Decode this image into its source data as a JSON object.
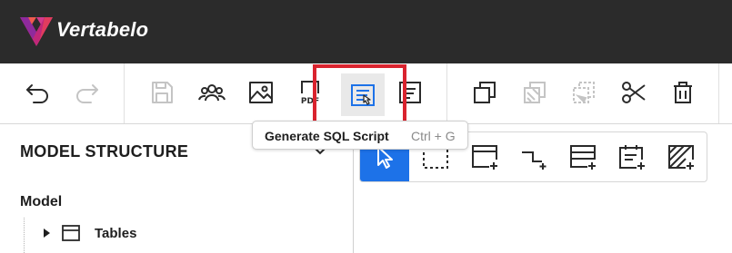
{
  "app": {
    "brand": "Vertabelo"
  },
  "toolbar": {
    "buttons": [
      {
        "name": "undo-button",
        "icon": "undo-icon",
        "enabled": true
      },
      {
        "name": "redo-button",
        "icon": "redo-icon",
        "enabled": false
      },
      {
        "name": "save-button",
        "icon": "save-icon",
        "enabled": false
      },
      {
        "name": "share-button",
        "icon": "users-icon",
        "enabled": true
      },
      {
        "name": "export-image-button",
        "icon": "image-icon",
        "enabled": true
      },
      {
        "name": "export-pdf-button",
        "icon": "pdf-icon",
        "enabled": true,
        "label": "PDF"
      },
      {
        "name": "generate-sql-button",
        "icon": "sql-script-icon",
        "enabled": true,
        "hovered": true
      },
      {
        "name": "report-button",
        "icon": "document-icon",
        "enabled": true
      },
      {
        "name": "copy-button",
        "icon": "copy-icon",
        "enabled": true
      },
      {
        "name": "paste-button",
        "icon": "paste-icon",
        "enabled": false
      },
      {
        "name": "paste-format-button",
        "icon": "paste-format-icon",
        "enabled": false
      },
      {
        "name": "cut-button",
        "icon": "scissors-icon",
        "enabled": true
      },
      {
        "name": "delete-button",
        "icon": "trash-icon",
        "enabled": true
      }
    ]
  },
  "tooltip": {
    "label": "Generate SQL Script",
    "shortcut": "Ctrl + G"
  },
  "left_panel": {
    "title": "MODEL STRUCTURE",
    "section": "Model",
    "tree": [
      {
        "label": "Tables",
        "icon": "table-icon",
        "expanded": false
      }
    ]
  },
  "diagram_toolbar": {
    "tools": [
      {
        "name": "select-tool",
        "icon": "pointer-icon",
        "selected": true
      },
      {
        "name": "area-select-tool",
        "icon": "dashed-rect-icon",
        "selected": false
      },
      {
        "name": "add-table-tool",
        "icon": "add-table-icon",
        "selected": false
      },
      {
        "name": "add-reference-tool",
        "icon": "add-reference-icon",
        "selected": false
      },
      {
        "name": "add-view-tool",
        "icon": "add-view-icon",
        "selected": false
      },
      {
        "name": "add-note-tool",
        "icon": "add-note-icon",
        "selected": false
      },
      {
        "name": "add-area-tool",
        "icon": "add-area-icon",
        "selected": false
      }
    ]
  },
  "colors": {
    "topbar": "#2b2b2b",
    "highlight": "#d9232e",
    "selected_tool": "#1d72e8",
    "disabled_icon": "#c4c4c4",
    "icon": "#2a2a2a"
  }
}
